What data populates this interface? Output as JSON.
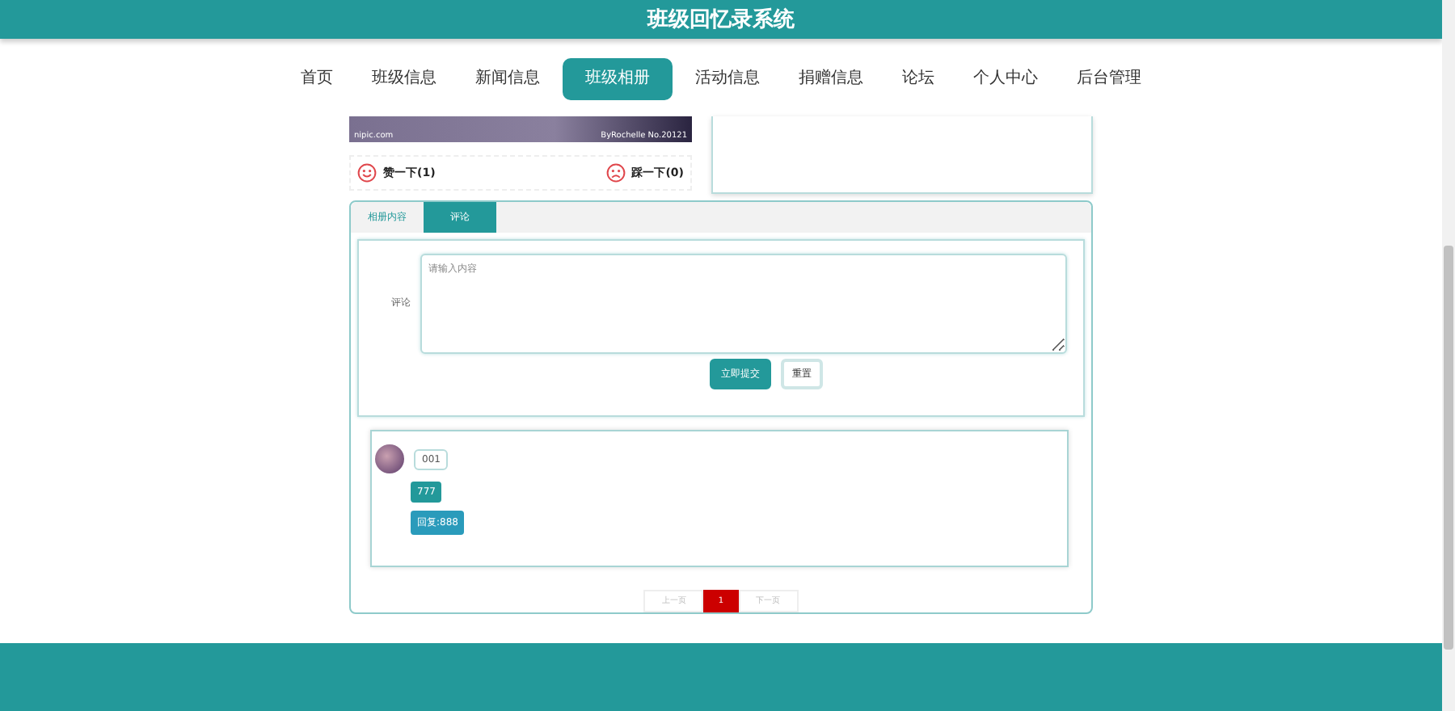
{
  "header": {
    "title": "班级回忆录系统"
  },
  "nav": [
    {
      "label": "首页",
      "selected": false
    },
    {
      "label": "班级信息",
      "selected": false
    },
    {
      "label": "新闻信息",
      "selected": false
    },
    {
      "label": "班级相册",
      "selected": true
    },
    {
      "label": "活动信息",
      "selected": false
    },
    {
      "label": "捐赠信息",
      "selected": false
    },
    {
      "label": "论坛",
      "selected": false
    },
    {
      "label": "个人中心",
      "selected": false
    },
    {
      "label": "后台管理",
      "selected": false
    }
  ],
  "photo": {
    "caption_left": "nipic.com",
    "caption_right": "ByRochelle  No.20121"
  },
  "votes": [
    {
      "kind": "like",
      "label": "赞一下(1)"
    },
    {
      "kind": "dislike",
      "label": "踩一下(0)"
    }
  ],
  "tabs": [
    {
      "label": "相册内容",
      "selected": false
    },
    {
      "label": "评论",
      "selected": true
    }
  ],
  "comment_form": {
    "label": "评论",
    "placeholder": "请输入内容",
    "buttons": [
      {
        "kind": "primary",
        "label": "立即提交"
      },
      {
        "kind": "plain",
        "label": "重置"
      }
    ]
  },
  "comments": [
    {
      "user": "001",
      "content": "777",
      "reply": "回复:888"
    }
  ],
  "pagination": {
    "prev": "上一页",
    "pages": [
      {
        "label": "1",
        "selected": true
      }
    ],
    "next": "下一页"
  }
}
